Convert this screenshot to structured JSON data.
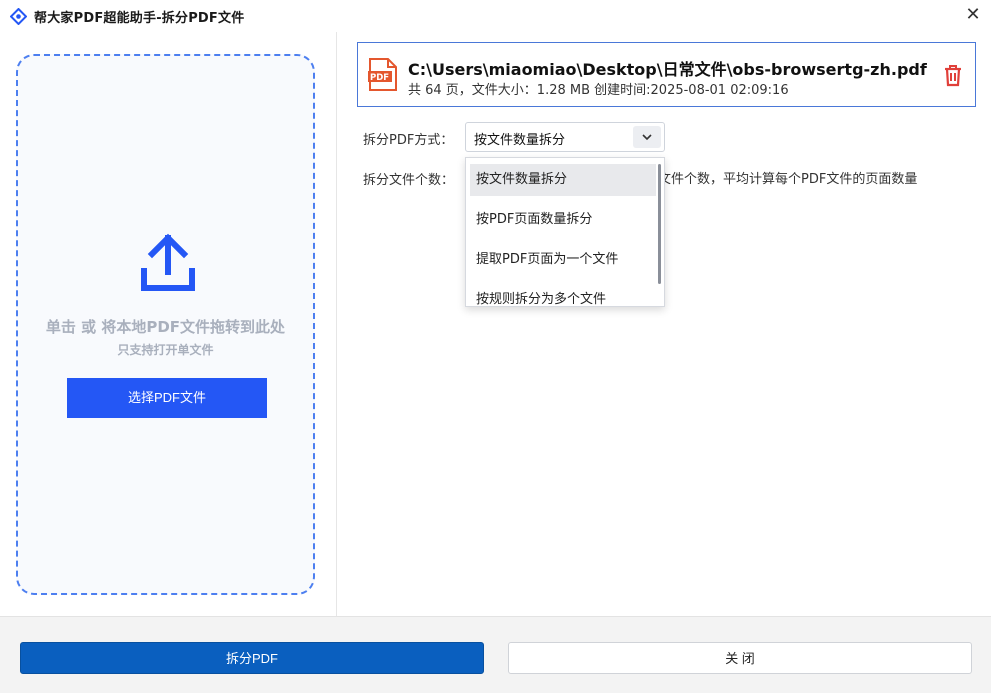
{
  "window": {
    "title": "帮大家PDF超能助手-拆分PDF文件",
    "close_glyph": "✕",
    "icon": "app-diamond-icon",
    "accent_color": "#2457f5"
  },
  "dropzone": {
    "main_text": "单击 或 将本地PDF文件拖转到此处",
    "sub_text": "只支持打开单文件",
    "select_button": "选择PDF文件",
    "icon": "upload-icon"
  },
  "file": {
    "path": "C:\\Users\\miaomiao\\Desktop\\日常文件\\obs-browsertg-zh.pdf",
    "meta": "共 64 页，文件大小：1.28 MB 创建时间:2025-08-01 02:09:16",
    "pdf_badge": "PDF",
    "delete_icon": "trash-icon",
    "delete_color": "#e0403a"
  },
  "options": {
    "method_label": "拆分PDF方式：",
    "method_selected": "按文件数量拆分",
    "count_label": "拆分文件个数：",
    "description": "文件个数，平均计算每个PDF文件的页面数量",
    "dropdown_items": [
      "按文件数量拆分",
      "按PDF页面数量拆分",
      "提取PDF页面为一个文件",
      "按规则拆分为多个文件"
    ]
  },
  "footer": {
    "split_button": "拆分PDF",
    "close_button": "关 闭"
  }
}
